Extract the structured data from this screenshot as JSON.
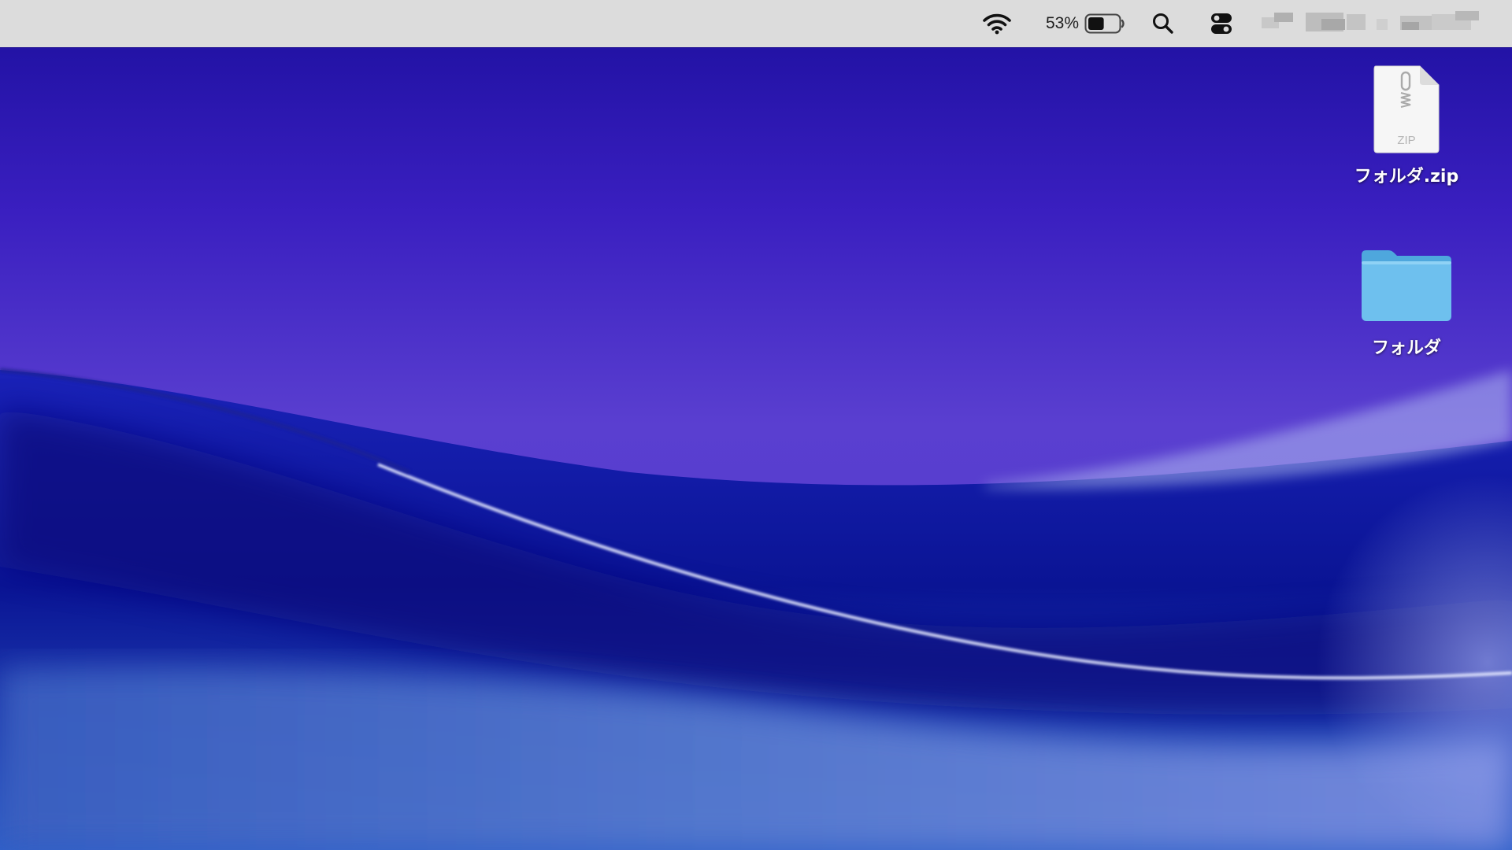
{
  "menubar": {
    "wifi_icon": "wifi-icon",
    "battery_percent": "53%",
    "battery_level": 0.53,
    "battery_icon": "battery-icon",
    "spotlight_icon": "magnifying-glass-icon",
    "control_center_icon": "control-center-icon",
    "background": "#dcdcdc"
  },
  "desktop": {
    "items": [
      {
        "label": "フォルダ.zip",
        "icon": "zip-archive-icon",
        "zip_badge": "ZIP"
      },
      {
        "label": "フォルダ",
        "icon": "folder-icon"
      }
    ],
    "folder_color": "#6ec0ee"
  }
}
